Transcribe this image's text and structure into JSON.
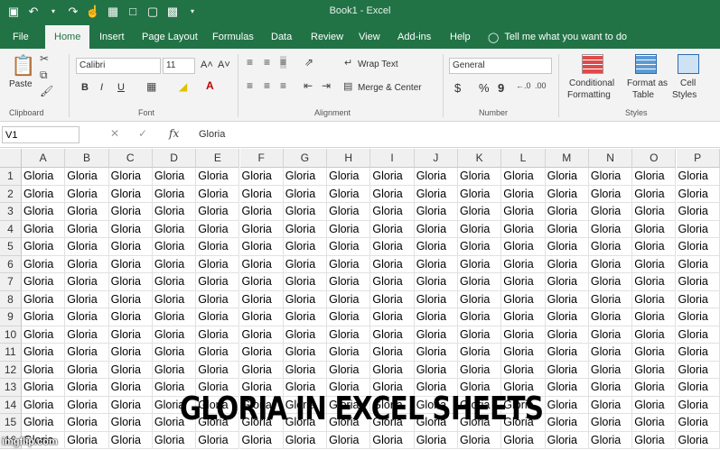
{
  "window": {
    "title": "Book1  -  Excel"
  },
  "tabs": [
    "File",
    "Home",
    "Insert",
    "Page Layout",
    "Formulas",
    "Data",
    "Review",
    "View",
    "Add-ins",
    "Help"
  ],
  "tell_me": "Tell me what you want to do",
  "ribbon": {
    "clipboard": {
      "paste": "Paste",
      "label": "Clipboard"
    },
    "font": {
      "name": "Calibri",
      "size": "11",
      "label": "Font",
      "grow": "A˄",
      "shrink": "A˅",
      "bold": "B",
      "italic": "I",
      "underline": "U"
    },
    "alignment": {
      "wrap": "Wrap Text",
      "merge": "Merge & Center",
      "label": "Alignment"
    },
    "number": {
      "format": "General",
      "currency": "$",
      "percent": "%",
      "comma": "9",
      "label": "Number"
    },
    "styles": {
      "conditional": [
        "Conditional",
        "Formatting"
      ],
      "format_table": [
        "Format as",
        "Table"
      ],
      "cell_styles": [
        "Cell",
        "Styles"
      ],
      "label": "Styles"
    }
  },
  "formula_bar": {
    "name_box": "V1",
    "fx": "fx",
    "value": "Gloria"
  },
  "sheet": {
    "columns": [
      "A",
      "B",
      "C",
      "D",
      "E",
      "F",
      "G",
      "H",
      "I",
      "J",
      "K",
      "L",
      "M",
      "N",
      "O",
      "P"
    ],
    "rows": [
      "1",
      "2",
      "3",
      "4",
      "5",
      "6",
      "7",
      "8",
      "9",
      "10",
      "11",
      "12",
      "13",
      "14",
      "15",
      "16"
    ],
    "cell_value": "Gloria"
  },
  "caption": "GLORIA IN EXCEL SHEETS",
  "watermark": "imgflip.com",
  "colors": {
    "accent": "#217346",
    "ribbon_bg": "#f3f3f3"
  }
}
